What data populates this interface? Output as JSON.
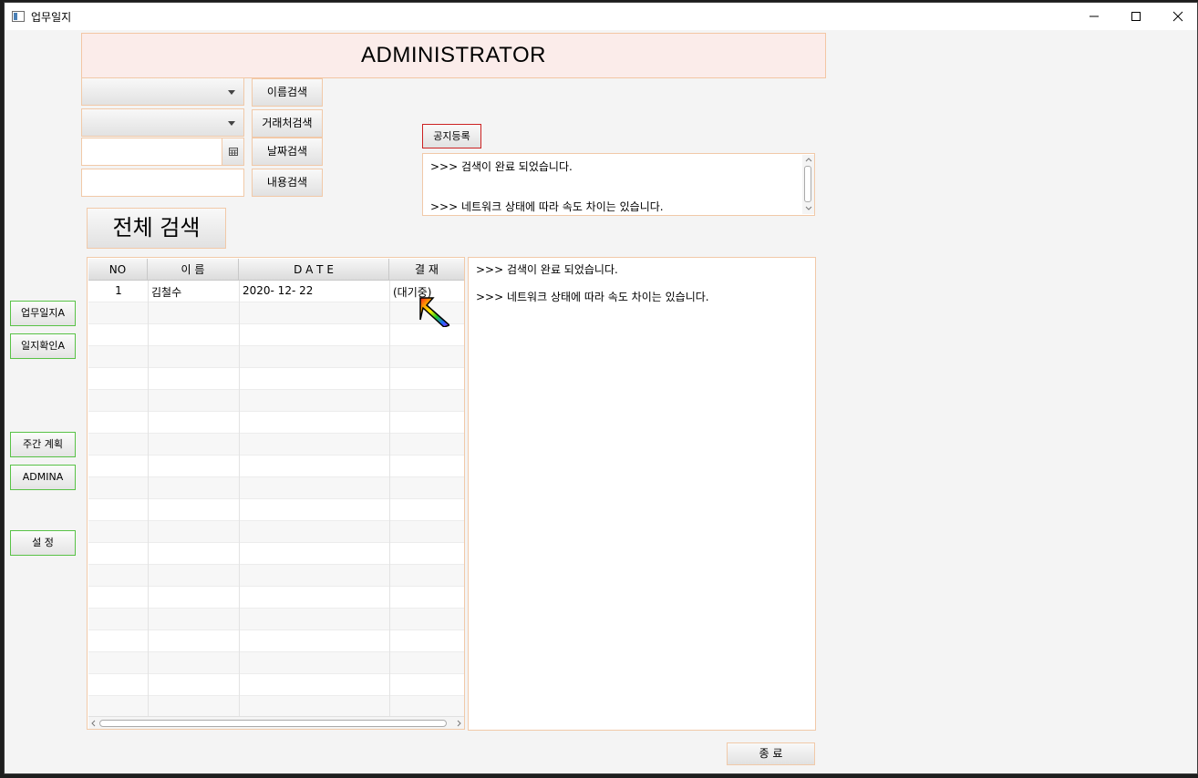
{
  "window": {
    "title": "업무일지"
  },
  "header": {
    "title": "ADMINISTRATOR"
  },
  "search": {
    "name_btn": "이름검색",
    "client_btn": "거래처검색",
    "date_btn": "날짜검색",
    "content_btn": "내용검색",
    "all_btn": "전체 검색",
    "combo1_value": "",
    "combo2_value": "",
    "date_value": "",
    "content_value": ""
  },
  "notice": {
    "register_btn": "공지등록",
    "lines": [
      ">>> 검색이 완료 되었습니다.",
      ">>> 네트워크 상태에 따라 속도 차이는 있습니다."
    ]
  },
  "sidebar": {
    "items": [
      {
        "label": "업무일지A"
      },
      {
        "label": "일지확인A"
      },
      {
        "label": "주간 계획"
      },
      {
        "label": "ADMINA"
      },
      {
        "label": "설  정"
      }
    ]
  },
  "table": {
    "columns": [
      "NO",
      "이   름",
      "D A T E",
      "결 재"
    ],
    "rows": [
      {
        "no": "1",
        "name": "김철수",
        "date": "2020- 12- 22",
        "status": "(대기중)"
      }
    ]
  },
  "log": {
    "lines": [
      ">>> 검색이 완료 되었습니다.",
      ">>> 네트워크 상태에 따라 속도 차이는 있습니다."
    ]
  },
  "footer": {
    "exit_btn": "종  료"
  },
  "colors": {
    "field_border": "#f1c9a8",
    "side_border": "#58c246",
    "header_bg": "#fbecea",
    "notice_border": "#cc2222"
  }
}
